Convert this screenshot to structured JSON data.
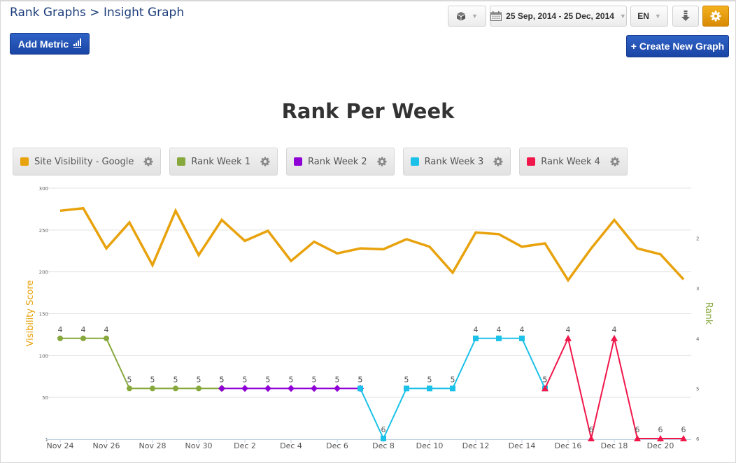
{
  "breadcrumb": {
    "parent": "Rank Graphs",
    "separator": ">",
    "current": "Insight Graph"
  },
  "toolbar": {
    "add_metric_label": "Add Metric",
    "create_graph_label": "+ Create New Graph",
    "date_range": "25 Sep, 2014 - 25 Dec, 2014",
    "language": "EN",
    "icons": {
      "cube": "cube-icon",
      "calendar": "calendar-icon",
      "download": "download-icon",
      "settings": "gear-icon",
      "caret": "▼"
    }
  },
  "colors": {
    "site_visibility": "#e8a20c",
    "week1": "#86a83c",
    "week2": "#8f00d6",
    "week3": "#1bc1e8",
    "week4": "#f0174a",
    "settings_accent": "#e89a0d",
    "primary_button": "#1f4fb5"
  },
  "chart_data": {
    "type": "line",
    "title": "Rank Per Week",
    "x": [
      "Nov 24",
      "Nov 25",
      "Nov 26",
      "Nov 27",
      "Nov 28",
      "Nov 29",
      "Nov 30",
      "Dec 1",
      "Dec 2",
      "Dec 3",
      "Dec 4",
      "Dec 5",
      "Dec 6",
      "Dec 7",
      "Dec 8",
      "Dec 9",
      "Dec 10",
      "Dec 11",
      "Dec 12",
      "Dec 13",
      "Dec 14",
      "Dec 15",
      "Dec 16",
      "Dec 17",
      "Dec 18",
      "Dec 19",
      "Dec 20",
      "Dec 21"
    ],
    "x_tick_labels": [
      "Nov 24",
      "Nov 26",
      "Nov 28",
      "Nov 30",
      "Dec 2",
      "Dec 4",
      "Dec 6",
      "Dec 8",
      "Dec 10",
      "Dec 12",
      "Dec 14",
      "Dec 16",
      "Dec 18",
      "Dec 20"
    ],
    "ylabel": "Visibility Score",
    "ylabel_right": "Rank",
    "y_ticks": [
      "1",
      "50",
      "100",
      "150",
      "200",
      "250",
      "300"
    ],
    "ylim": [
      0,
      300
    ],
    "y2_ticks": [
      "2",
      "3",
      "4",
      "5",
      "6"
    ],
    "y2lim": [
      1,
      6
    ],
    "y2_reversed": true,
    "grid": true,
    "legend_position": "top",
    "legend": [
      "Site Visibility - Google",
      "Rank Week 1",
      "Rank Week 2",
      "Rank Week 3",
      "Rank Week 4"
    ],
    "series": [
      {
        "name": "Site Visibility - Google",
        "axis": "left",
        "marker": "none",
        "start_index": 0,
        "values": [
          273,
          276,
          228,
          259,
          208,
          273,
          220,
          262,
          237,
          249,
          213,
          236,
          222,
          228,
          227,
          239,
          230,
          199,
          247,
          245,
          230,
          234,
          190,
          228,
          262,
          228,
          221,
          191
        ]
      },
      {
        "name": "Rank Week 1",
        "axis": "right",
        "marker": "circle",
        "start_index": 0,
        "values": [
          4,
          4,
          4,
          5,
          5,
          5,
          5,
          5
        ]
      },
      {
        "name": "Rank Week 2",
        "axis": "right",
        "marker": "diamond",
        "start_index": 7,
        "values": [
          5,
          5,
          5,
          5,
          5,
          5,
          5
        ]
      },
      {
        "name": "Rank Week 3",
        "axis": "right",
        "marker": "square",
        "start_index": 13,
        "values": [
          5,
          6,
          5,
          5,
          5,
          4,
          4,
          4,
          5
        ]
      },
      {
        "name": "Rank Week 4",
        "axis": "right",
        "marker": "triangle",
        "start_index": 21,
        "values": [
          5,
          4,
          6,
          4,
          6,
          6,
          6
        ]
      }
    ]
  }
}
